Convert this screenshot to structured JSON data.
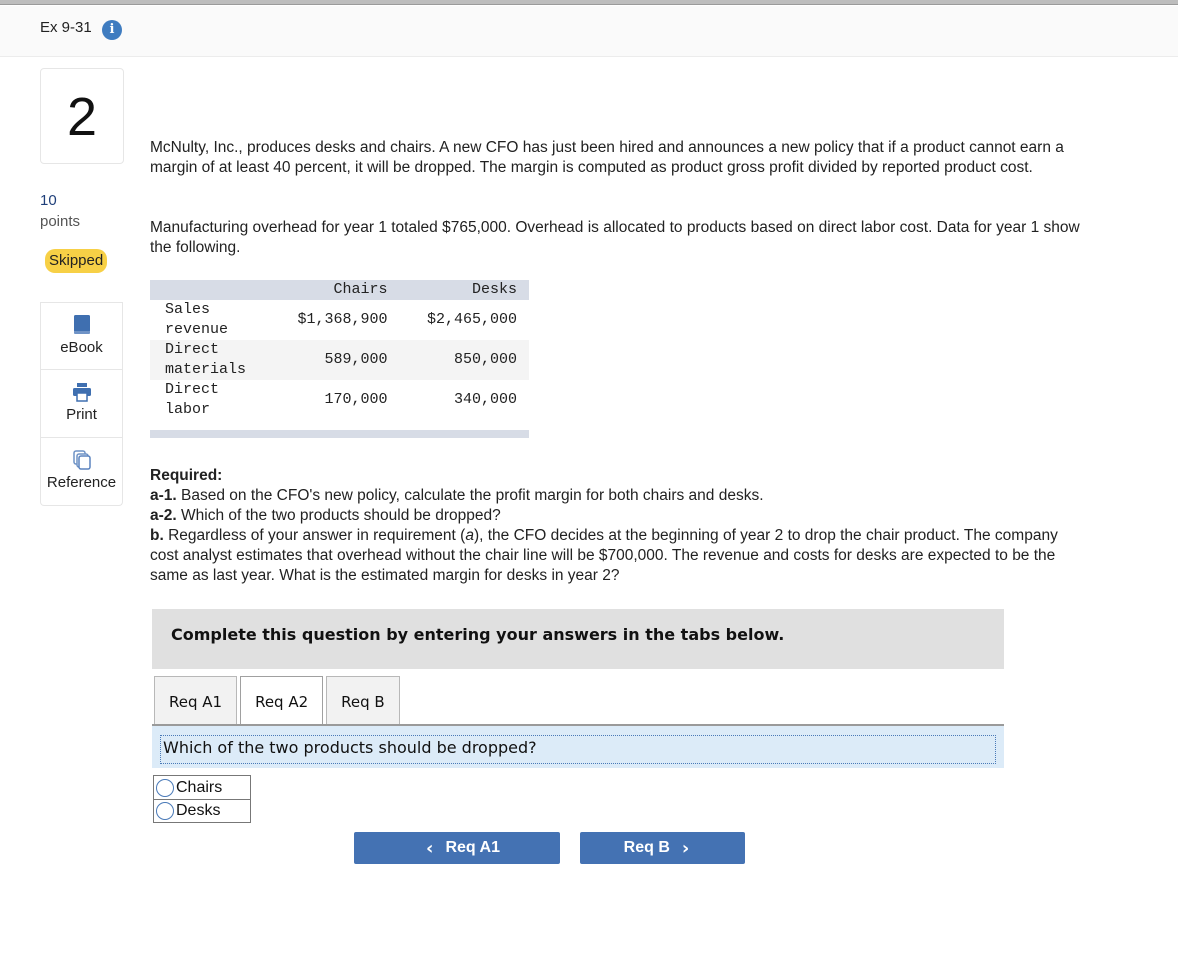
{
  "header": {
    "title": "Ex 9-31",
    "info_icon": "info-icon"
  },
  "question": {
    "number": "2",
    "points_value": "10",
    "points_label": "points",
    "status": "Skipped"
  },
  "side_tools": [
    {
      "label": "eBook",
      "icon": "book-icon"
    },
    {
      "label": "Print",
      "icon": "printer-icon"
    },
    {
      "label": "Reference",
      "icon": "copy-icon"
    }
  ],
  "body": {
    "paragraph1": "McNulty, Inc., produces desks and chairs. A new CFO has just been hired and announces a new policy that if a product cannot earn a margin of at least 40 percent, it will be dropped. The margin is computed as product gross profit divided by reported product cost.",
    "paragraph2": "Manufacturing overhead for year 1 totaled $765,000. Overhead is allocated to products based on direct labor cost. Data for year 1 show the following."
  },
  "table": {
    "headers": [
      "",
      "Chairs",
      "Desks"
    ],
    "rows": [
      {
        "label": "Sales revenue",
        "chairs": "$1,368,900",
        "desks": "$2,465,000"
      },
      {
        "label": "Direct materials",
        "chairs": "589,000",
        "desks": "850,000"
      },
      {
        "label": "Direct labor",
        "chairs": "170,000",
        "desks": "340,000"
      }
    ]
  },
  "required": {
    "heading": "Required:",
    "a1_key": "a-1.",
    "a1_text": " Based on the CFO's new policy, calculate the profit margin for both chairs and desks.",
    "a2_key": "a-2.",
    "a2_text": " Which of the two products should be dropped?",
    "b_key": "b.",
    "b_text_1": " Regardless of your answer in requirement (",
    "b_italic": "a",
    "b_text_2": "), the CFO decides at the beginning of year 2 to drop the chair product. The company cost analyst estimates that overhead without the chair line will be $700,000. The revenue and costs for desks are expected to be the same as last year. What is the estimated margin for desks in year 2?"
  },
  "instructions": "Complete this question by entering your answers in the tabs below.",
  "tabs": [
    {
      "label": "Req A1",
      "active": false
    },
    {
      "label": "Req A2",
      "active": true
    },
    {
      "label": "Req B",
      "active": false
    }
  ],
  "prompt": "Which of the two products should be dropped?",
  "options": [
    {
      "label": "Chairs",
      "selected": false
    },
    {
      "label": "Desks",
      "selected": false
    }
  ],
  "nav": {
    "prev_label": "Req A1",
    "prev_icon": "chevron-left-icon",
    "next_label": "Req B",
    "next_icon": "chevron-right-icon"
  }
}
